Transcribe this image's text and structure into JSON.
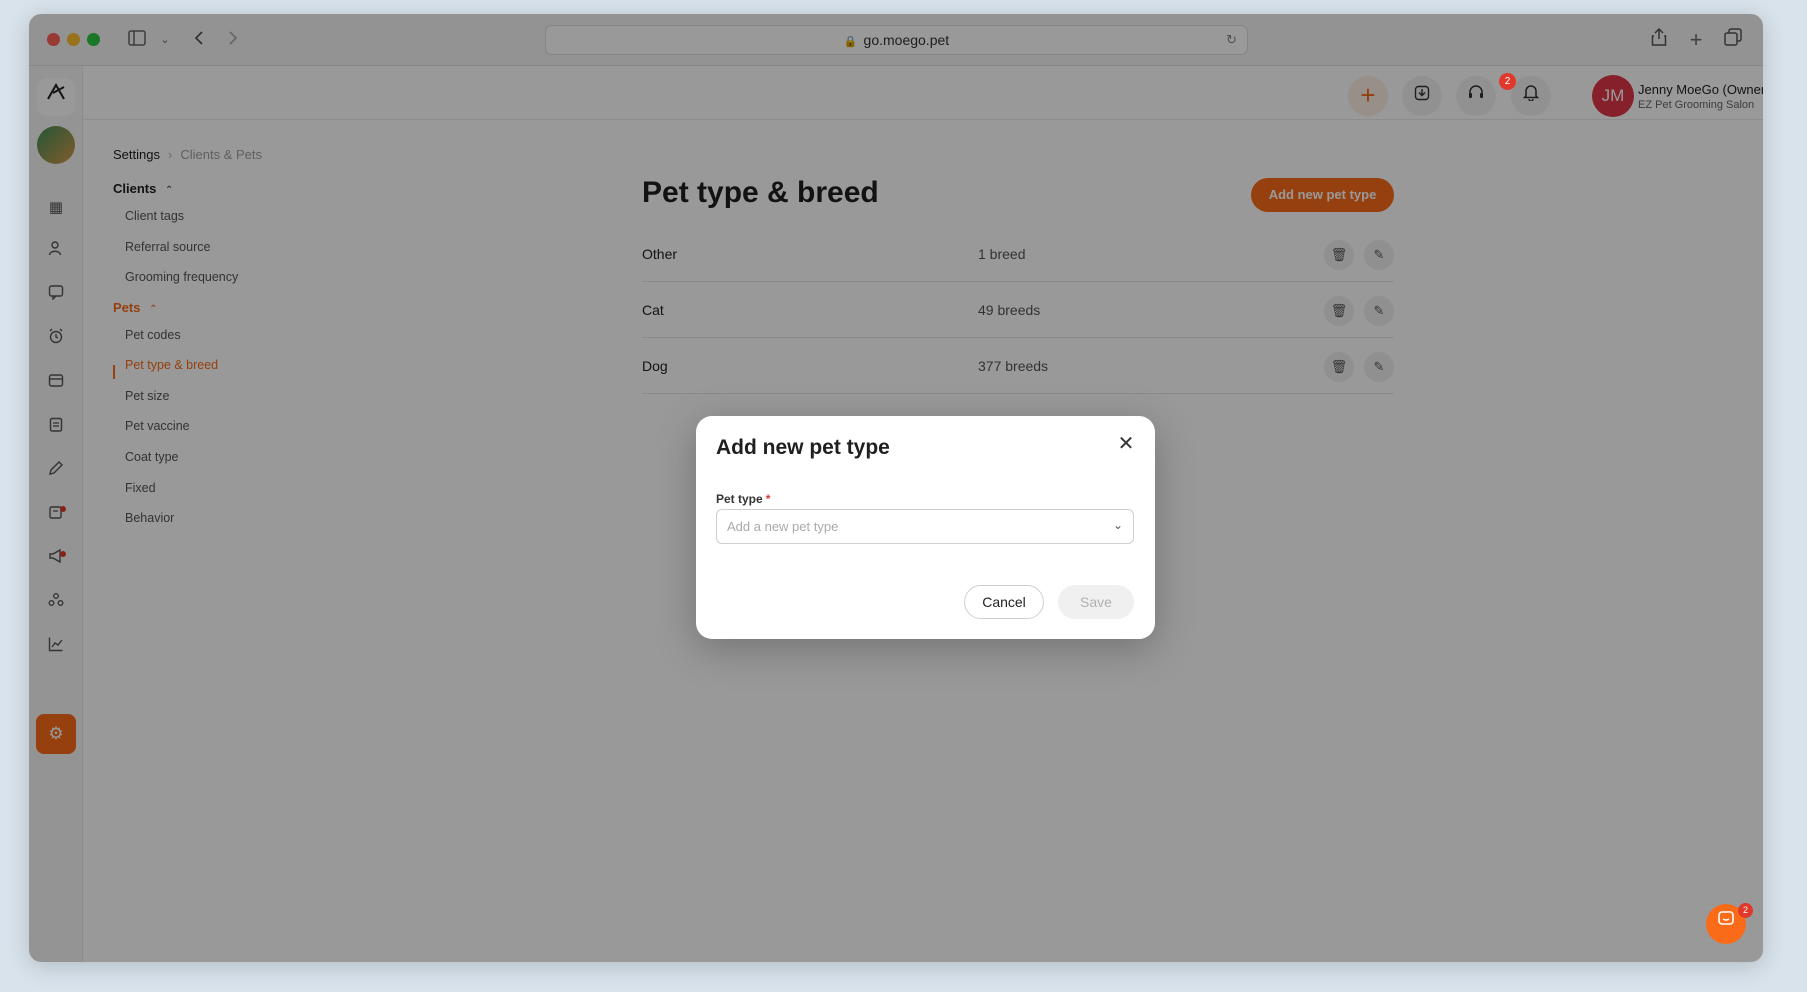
{
  "browser": {
    "url": "go.moego.pet"
  },
  "header": {
    "notification_count": "2",
    "user_initials": "JM",
    "user_name": "Jenny MoeGo (Owner)",
    "business_name": "EZ Pet Grooming Salon"
  },
  "breadcrumb": {
    "root": "Settings",
    "current": "Clients & Pets"
  },
  "sidebar": {
    "clients_label": "Clients",
    "clients_items": [
      "Client tags",
      "Referral source",
      "Grooming frequency"
    ],
    "pets_label": "Pets",
    "pets_items": [
      "Pet codes",
      "Pet type & breed",
      "Pet size",
      "Pet vaccine",
      "Coat type",
      "Fixed",
      "Behavior"
    ],
    "active_item": "Pet type & breed"
  },
  "main": {
    "title": "Pet type & breed",
    "add_button": "Add new pet type",
    "rows": [
      {
        "name": "Other",
        "count": "1 breed"
      },
      {
        "name": "Cat",
        "count": "49 breeds"
      },
      {
        "name": "Dog",
        "count": "377 breeds"
      }
    ]
  },
  "modal": {
    "title": "Add new pet type",
    "field_label": "Pet type",
    "required_mark": "*",
    "placeholder": "Add a new pet type",
    "cancel_label": "Cancel",
    "save_label": "Save"
  },
  "intercom": {
    "badge": "2"
  },
  "colors": {
    "accent": "#f96b18",
    "badge": "#e0382a",
    "avatar": "#e0384a"
  }
}
